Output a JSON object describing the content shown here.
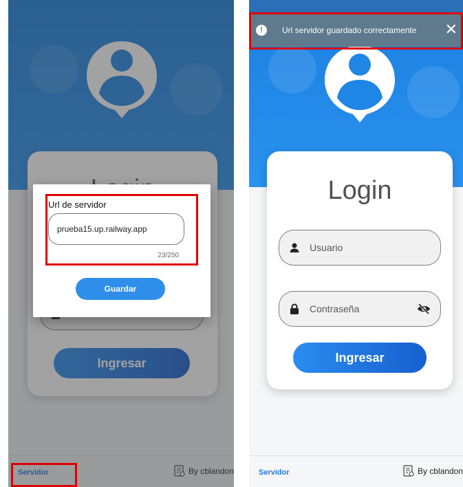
{
  "left": {
    "login_title": "Login",
    "ingresar_label": "Ingresar",
    "dialog": {
      "label": "Url de servidor",
      "input_value": "prueba15.up.railway.app",
      "counter": "23/250",
      "guardar_label": "Guardar"
    },
    "footer": {
      "servidor_label": "Servidor",
      "by_label": "By cblandon"
    }
  },
  "right": {
    "snackbar": {
      "message": "Url servidor guardado correctamente",
      "info_glyph": "!",
      "close_glyph": "✕"
    },
    "login_title": "Login",
    "usuario_placeholder": "Usuario",
    "contrasena_placeholder": "Contraseña",
    "ingresar_label": "Ingresar",
    "footer": {
      "servidor_label": "Servidor",
      "by_label": "By cblandon"
    }
  },
  "colors": {
    "hero_blue": "#1b7fe0",
    "button_gradient_start": "#2a8cf0",
    "button_gradient_end": "#1760cf",
    "highlight_red": "#e00000",
    "snackbar_bg": "#5e7a8c",
    "link_blue": "#1e78d9"
  },
  "icons": {
    "avatar": "user-location-pin-icon",
    "usuario": "person-icon",
    "contrasena": "lock-icon",
    "visibility": "eye-off-icon",
    "footer": "developer-badge-icon",
    "snackbar_info": "info-icon",
    "snackbar_close": "close-icon"
  }
}
